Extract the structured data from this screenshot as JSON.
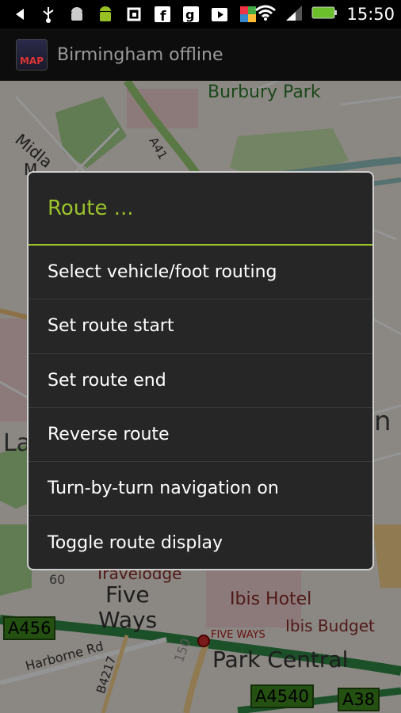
{
  "status_bar": {
    "time": "15:50",
    "icons": [
      "back-icon",
      "usb-icon",
      "android-debug-icon",
      "android-icon",
      "refresh-icon",
      "facebook-icon",
      "google-icon",
      "play-store-icon",
      "apps-icon",
      "wifi-icon",
      "signal-icon",
      "battery-icon"
    ]
  },
  "action_bar": {
    "app_icon_text": "MAP",
    "title": "Birmingham offline"
  },
  "map": {
    "labels": {
      "burbury_park": "Burbury Park",
      "midla": "Midla",
      "m": "M",
      "a41": "A41",
      "n_right": "n",
      "la": "La",
      "travelodge": "Travelodge",
      "five": "Five",
      "ways": "Ways",
      "ibis_hotel": "Ibis Hotel",
      "ibis_budget": "Ibis Budget",
      "five_ways_station": "FIVE WAYS",
      "harborne_rd": "Harborne Rd",
      "b4217": "B4217",
      "park_central": "Park Central",
      "n150": "150",
      "n60": "60"
    },
    "road_badges": {
      "a456": "A456",
      "a4540": "A4540",
      "a38": "A38"
    }
  },
  "dialog": {
    "title": "Route ...",
    "items": [
      "Select vehicle/foot routing",
      "Set route start",
      "Set route end",
      "Reverse route",
      "Turn-by-turn navigation on",
      "Toggle route display"
    ]
  }
}
